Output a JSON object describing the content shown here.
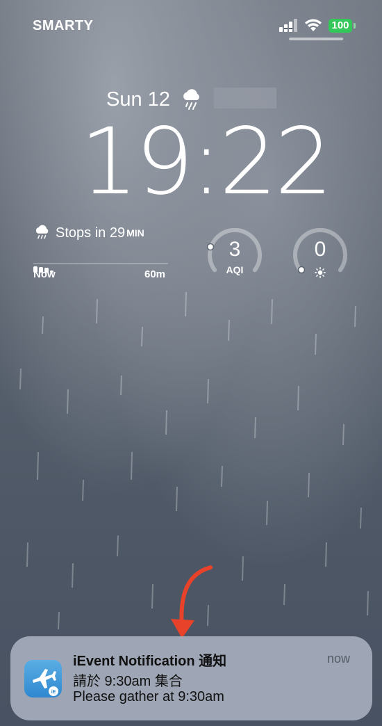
{
  "status_bar": {
    "carrier": "SMARTY",
    "battery": "100",
    "colors": {
      "battery": "#34c759"
    }
  },
  "lock_screen": {
    "date": "Sun 12",
    "date_icon": "cloud-rain-icon",
    "time": "19:22"
  },
  "widgets": {
    "rain": {
      "icon": "cloud-rain-icon",
      "title": "Stops in 29",
      "title_unit": "MIN",
      "axis_start": "Now",
      "axis_end": "60m"
    },
    "aqi": {
      "value": "3",
      "label": "AQI",
      "level": 0.03
    },
    "uv": {
      "value": "0",
      "icon": "sun-icon",
      "level": 0.0
    }
  },
  "notification": {
    "app_icon": "airplane-icon",
    "badge": "iE",
    "title": "iEvent Notification 通知",
    "time": "now",
    "line1": "請於 9:30am 集合",
    "line2": "Please gather at 9:30am"
  },
  "annotation": {
    "icon": "red-arrow-icon",
    "color": "#e8432a"
  }
}
